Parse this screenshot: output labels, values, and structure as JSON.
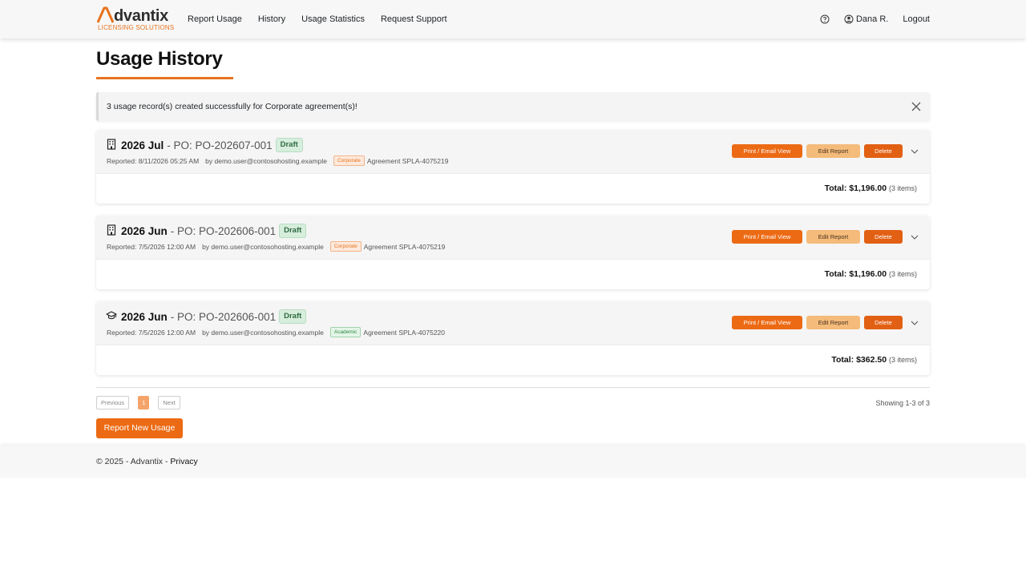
{
  "brand": {
    "name": "dvantix",
    "tagline": "LICENSING SOLUTIONS",
    "accent": "#e8731f"
  },
  "nav": {
    "links": [
      "Report Usage",
      "History",
      "Usage Statistics",
      "Request Support"
    ],
    "user": "Dana R.",
    "logout": "Logout"
  },
  "page": {
    "title": "Usage History"
  },
  "alert": {
    "message": "3 usage record(s) created successfully for Corporate agreement(s)!"
  },
  "records": [
    {
      "icon": "building-icon",
      "period": "2026 Jul",
      "po": "- PO: PO-202607-001",
      "status": "Draft",
      "reported": "Reported: 8/11/2026 05:25 AM",
      "by": "by demo.user@contosohosting.example",
      "type": "Corporate",
      "agreement": "Agreement SPLA-4075219",
      "total_label": "Total:",
      "total": "$1,196.00",
      "items": "(3 items)"
    },
    {
      "icon": "building-icon",
      "period": "2026 Jun",
      "po": "- PO: PO-202606-001",
      "status": "Draft",
      "reported": "Reported: 7/5/2026 12:00 AM",
      "by": "by demo.user@contosohosting.example",
      "type": "Corporate",
      "agreement": "Agreement SPLA-4075219",
      "total_label": "Total:",
      "total": "$1,196.00",
      "items": "(3 items)"
    },
    {
      "icon": "graduation-cap-icon",
      "period": "2026 Jun",
      "po": "- PO: PO-202606-001",
      "status": "Draft",
      "reported": "Reported: 7/5/2026 12:00 AM",
      "by": "by demo.user@contosohosting.example",
      "type": "Academic",
      "agreement": "Agreement SPLA-4075220",
      "total_label": "Total:",
      "total": "$362.50",
      "items": "(3 items)"
    }
  ],
  "actions": {
    "print": "Print / Email View",
    "edit": "Edit Report",
    "delete": "Delete"
  },
  "pagination": {
    "previous": "Previous",
    "current": "1",
    "next": "Next",
    "showing": "Showing 1-3 of 3"
  },
  "report_new": "Report New Usage",
  "footer": {
    "copyright": "© 2025 - Advantix - ",
    "privacy": "Privacy"
  }
}
